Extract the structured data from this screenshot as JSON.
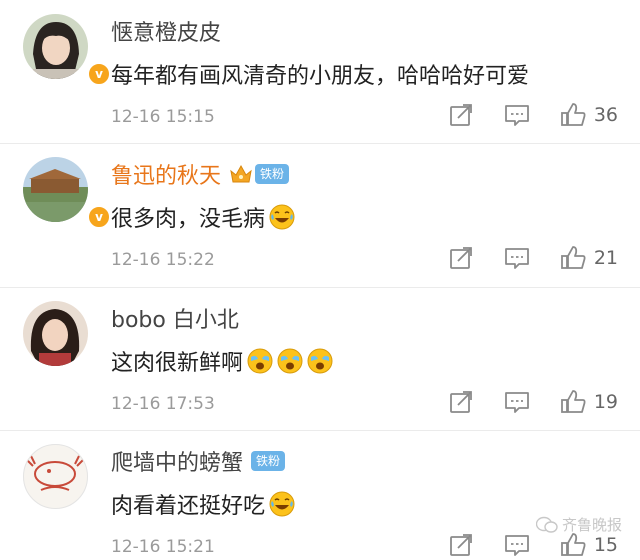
{
  "comments": [
    {
      "username": "惬意橙皮皮",
      "text": "每年都有画风清奇的小朋友，哈哈哈好可爱",
      "time": "12-16 15:15",
      "likes": "36",
      "verified": true
    },
    {
      "username": "鲁迅的秋天",
      "badge": "铁粉",
      "text": "很多肉，没毛病",
      "emojis": [
        "laugh-cry"
      ],
      "time": "12-16 15:22",
      "likes": "21",
      "verified": true
    },
    {
      "username": "bobo 白小北",
      "text": "这肉很新鲜啊",
      "emojis": [
        "tears",
        "tears",
        "tears"
      ],
      "time": "12-16 17:53",
      "likes": "19"
    },
    {
      "username": "爬墙中的螃蟹",
      "badge": "铁粉",
      "text": "肉看着还挺好吃",
      "emojis": [
        "laugh-cry"
      ],
      "time": "12-16 15:21",
      "likes": "15"
    }
  ],
  "watermark": "齐鲁晚报",
  "colors": {
    "vip_name": "#e8761a",
    "fan_badge": "#6bb3e8",
    "verified": "#f7a51c"
  }
}
